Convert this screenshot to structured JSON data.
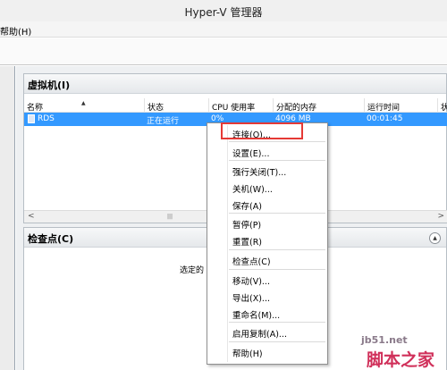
{
  "window": {
    "title": "Hyper-V 管理器"
  },
  "menubar": {
    "help_label": "帮助(H)"
  },
  "vm_panel": {
    "title": "虚拟机(I)",
    "columns": [
      "名称",
      "状态",
      "CPU 使用率",
      "分配的内存",
      "运行时间",
      "状"
    ],
    "row": {
      "name": "RDS",
      "status": "正在运行",
      "cpu": "0%",
      "memory": "4096 MB",
      "uptime": "00:01:45"
    }
  },
  "checkpoint_panel": {
    "title": "检查点(C)",
    "empty_text": "选定的"
  },
  "context_menu": {
    "items": [
      "连接(O)...",
      "设置(E)...",
      "强行关闭(T)...",
      "关机(W)...",
      "保存(A)",
      "暂停(P)",
      "重置(R)",
      "检查点(C)",
      "移动(V)...",
      "导出(X)...",
      "重命名(M)...",
      "启用复制(A)...",
      "帮助(H)"
    ]
  },
  "watermark": {
    "site": "jb51.net",
    "brand": "脚本之家"
  },
  "colors": {
    "selection": "#3399ff",
    "highlight_box": "#e53935"
  }
}
